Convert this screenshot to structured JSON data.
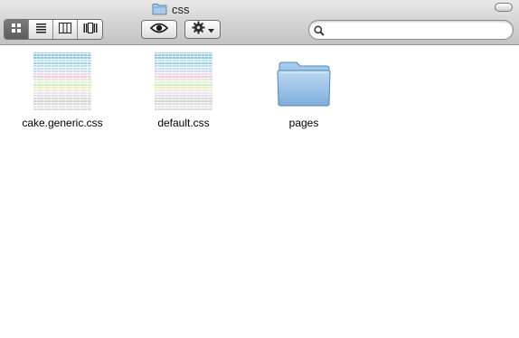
{
  "window": {
    "title": "css",
    "title_icon": "folder-icon"
  },
  "toolbar": {
    "view_buttons": [
      {
        "name": "icon-view",
        "icon": "grid-icon",
        "active": true
      },
      {
        "name": "list-view",
        "icon": "list-icon",
        "active": false
      },
      {
        "name": "column-view",
        "icon": "columns-icon",
        "active": false
      },
      {
        "name": "cover-flow-view",
        "icon": "coverflow-icon",
        "active": false
      }
    ],
    "quick_look_icon": "eye-icon",
    "action_icon": "gear-icon",
    "action_menu_icon": "chevron-down-icon",
    "search": {
      "value": "",
      "placeholder": "",
      "icon": "search-icon"
    }
  },
  "files": [
    {
      "name": "cake.generic.css",
      "kind": "css-thumbnail"
    },
    {
      "name": "default.css",
      "kind": "css-thumbnail"
    },
    {
      "name": "pages",
      "kind": "folder"
    }
  ],
  "colors": {
    "folder_blue": "#8fbde3",
    "toolbar_top": "#e9e9e9",
    "toolbar_bottom": "#c2c2c2"
  }
}
